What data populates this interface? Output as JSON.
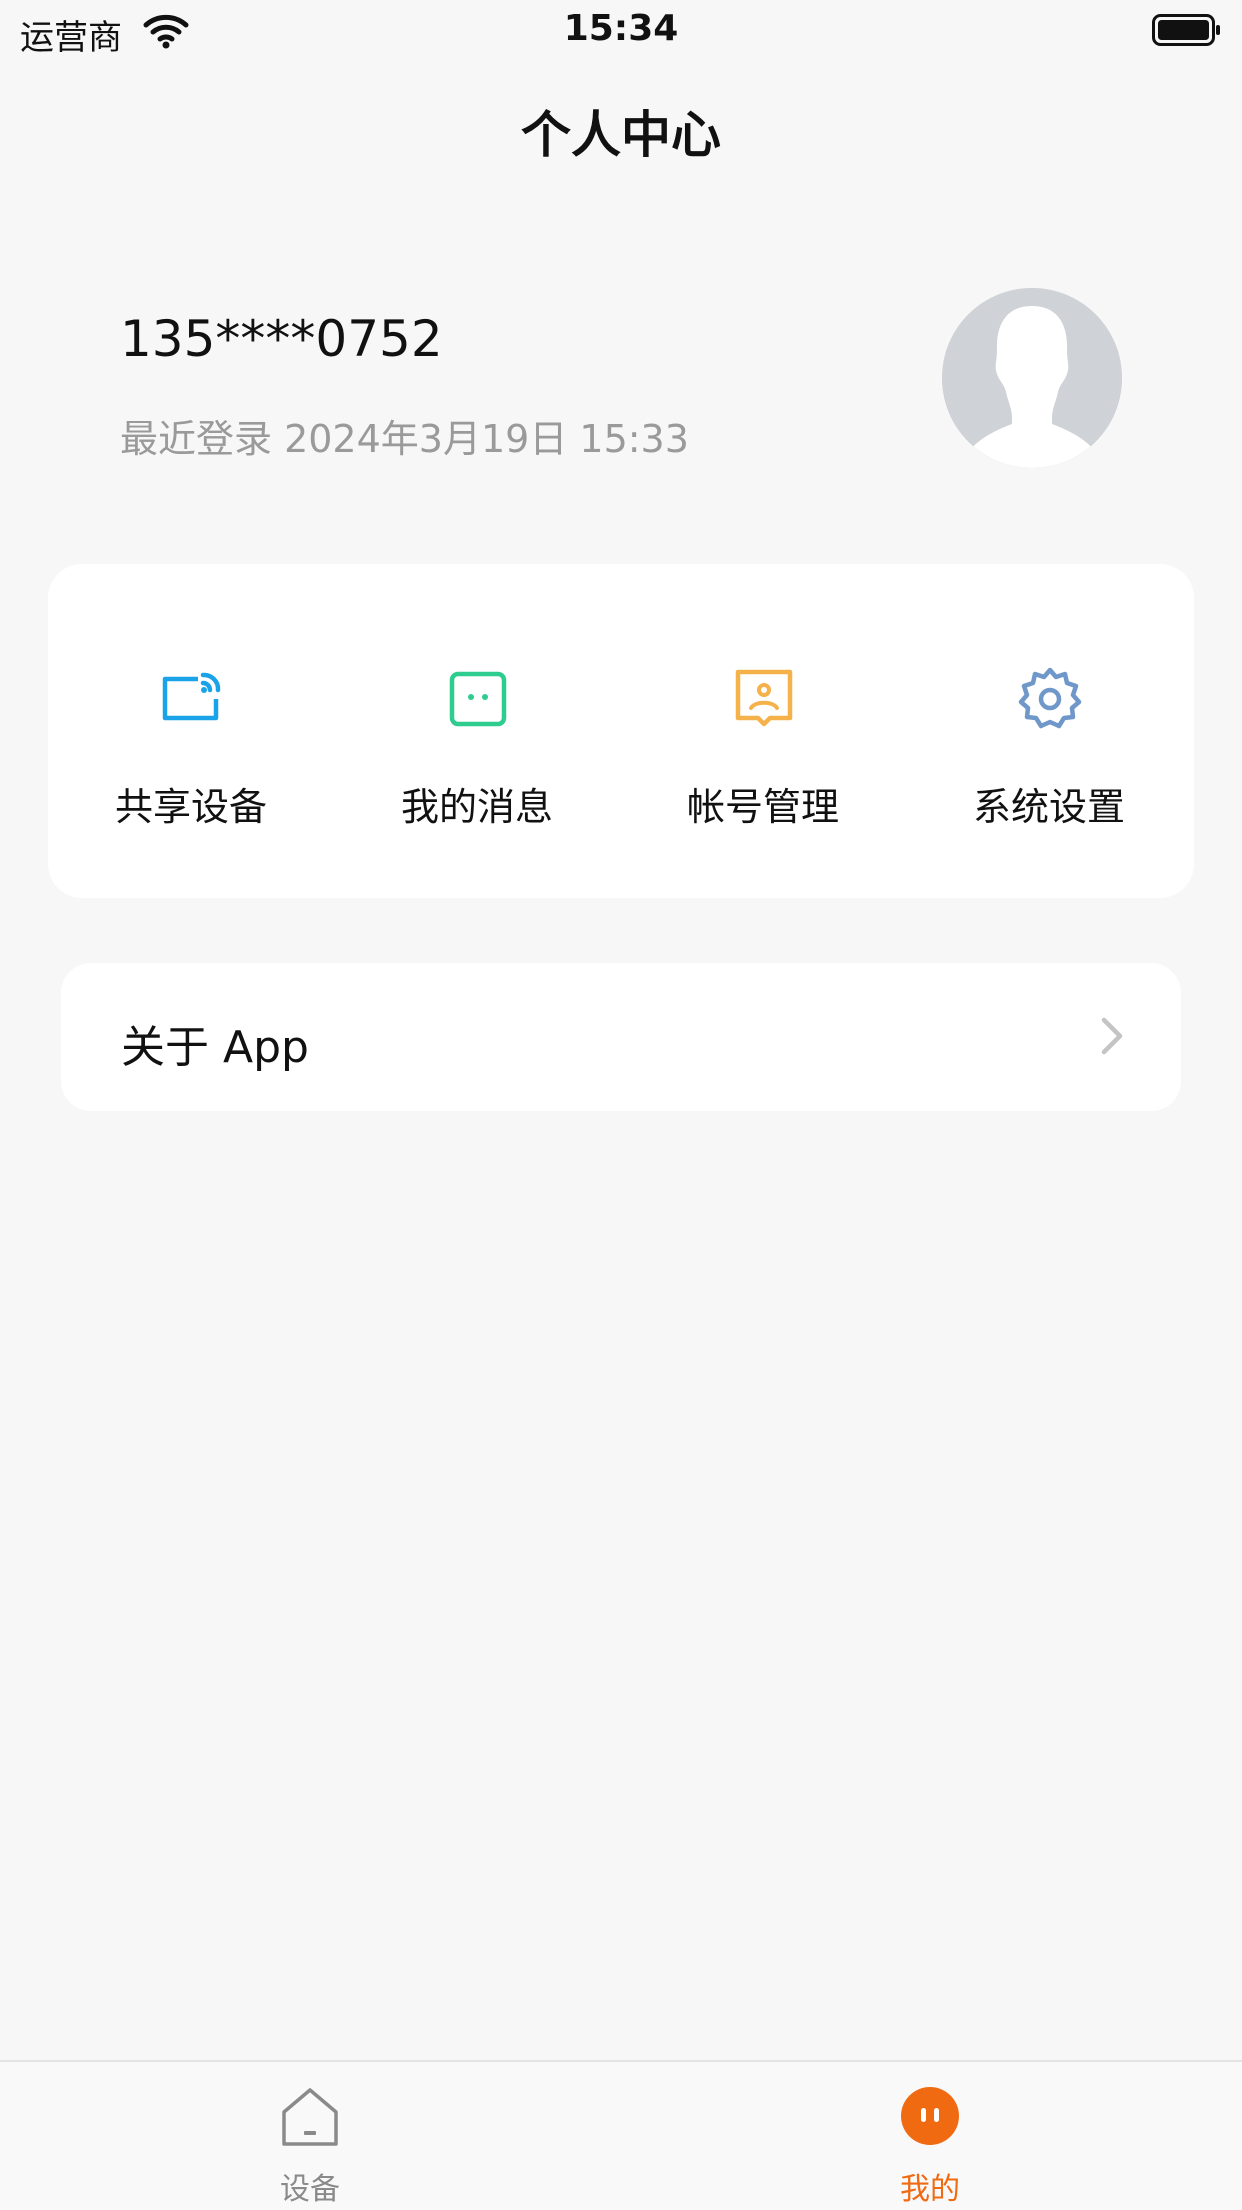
{
  "status_bar": {
    "carrier": "运营商",
    "time": "15:34"
  },
  "header": {
    "title": "个人中心"
  },
  "profile": {
    "phone": "135****0752",
    "last_login": "最近登录 2024年3月19日 15:33"
  },
  "quick_actions": [
    {
      "label": "共享设备",
      "icon": "share-device-icon",
      "color": "#1aa3e8"
    },
    {
      "label": "我的消息",
      "icon": "message-icon",
      "color": "#2ecc8f"
    },
    {
      "label": "帐号管理",
      "icon": "account-icon",
      "color": "#f5b24a"
    },
    {
      "label": "系统设置",
      "icon": "gear-icon",
      "color": "#6f97c9"
    }
  ],
  "about": {
    "label": "关于 App"
  },
  "tabbar": {
    "tabs": [
      {
        "label": "设备",
        "icon": "device-tab-icon",
        "active": false
      },
      {
        "label": "我的",
        "icon": "my-tab-icon",
        "active": true
      }
    ],
    "active_color": "#f06a12",
    "inactive_color": "#8a8a8a"
  }
}
